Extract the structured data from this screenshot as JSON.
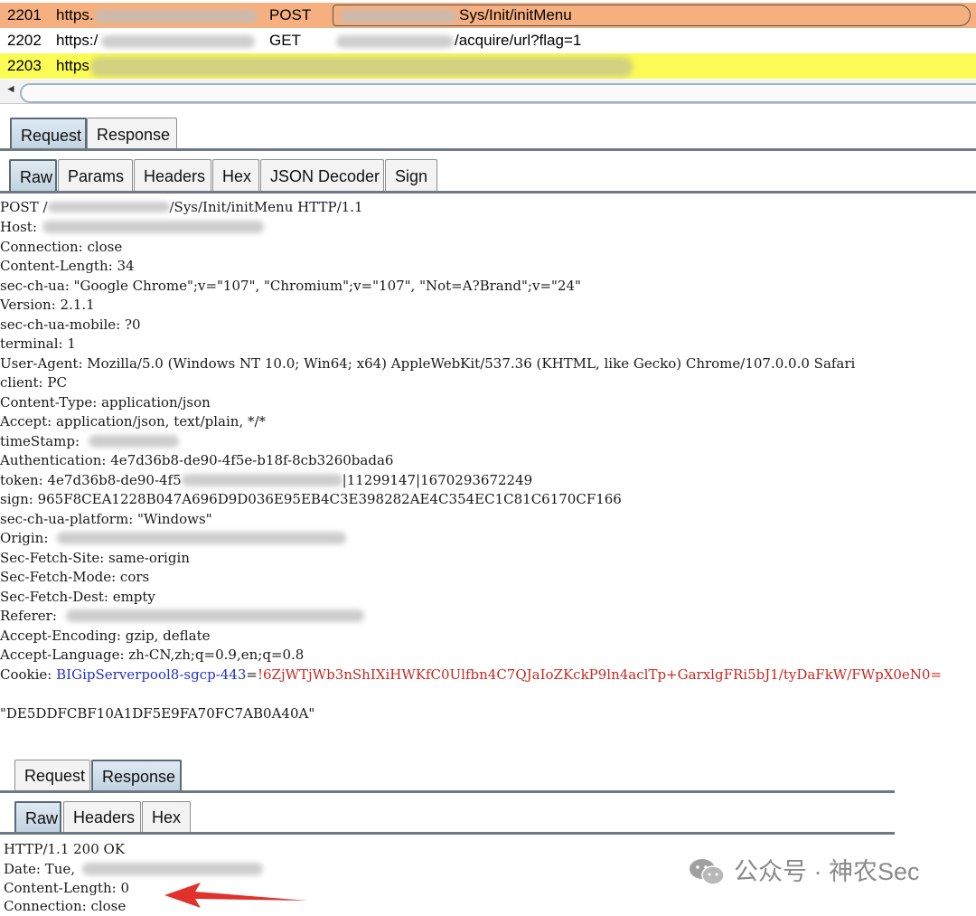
{
  "history": [
    {
      "id": "2201",
      "scheme": "https.",
      "method": "POST",
      "path": "Sys/Init/initMenu",
      "style": "orange"
    },
    {
      "id": "2202",
      "scheme": "https:/",
      "method": "GET",
      "path": "/acquire/url?flag=1",
      "style": "white"
    },
    {
      "id": "2203",
      "scheme": "https",
      "method": "",
      "path": "",
      "style": "yellow"
    }
  ],
  "request_pane": {
    "top_tabs": [
      "Request",
      "Response"
    ],
    "sub_tabs": [
      "Raw",
      "Params",
      "Headers",
      "Hex",
      "JSON Decoder",
      "Sign"
    ],
    "lines": [
      "POST /",
      "Host:",
      "Connection: close",
      "Content-Length: 34",
      "sec-ch-ua: \"Google Chrome\";v=\"107\", \"Chromium\";v=\"107\", \"Not=A?Brand\";v=\"24\"",
      "Version: 2.1.1",
      "sec-ch-ua-mobile: ?0",
      "terminal: 1",
      "User-Agent: Mozilla/5.0 (Windows NT 10.0; Win64; x64) AppleWebKit/537.36 (KHTML, like Gecko) Chrome/107.0.0.0 Safari",
      "client: PC",
      "Content-Type: application/json",
      "Accept: application/json, text/plain, */*",
      "timeStamp:",
      "Authentication: 4e7d36b8-de90-4f5e-b18f-8cb3260bada6",
      "token: 4e7d36b8-de90-4f5",
      "sign: 965F8CEA1228B047A696D9D036E95EB4C3E398282AE4C354EC1C81C6170CF166",
      "sec-ch-ua-platform: \"Windows\"",
      "Origin:",
      "Sec-Fetch-Site: same-origin",
      "Sec-Fetch-Mode: cors",
      "Sec-Fetch-Dest: empty",
      "Referer:",
      "Accept-Encoding: gzip, deflate",
      "Accept-Language: zh-CN,zh;q=0.9,en;q=0.8"
    ],
    "first_line_suffix": "/Sys/Init/initMenu HTTP/1.1",
    "token_suffix": "|11299147|1670293672249",
    "cookie": {
      "label": "Cookie:",
      "name": "BIGipServerpool8-sgcp-443",
      "eq": "=",
      "value": "!6ZjWTjWb3nShIXiHWKfC0Ulfbn4C7QJaIoZKckP9ln4aclTp+GarxlgFRi5bJ1/tyDaFkW/FWpX0eN0="
    },
    "body": "\"DE5DDFCBF10A1DF5E9FA70FC7AB0A40A\""
  },
  "response_pane": {
    "top_tabs": [
      "Request",
      "Response"
    ],
    "sub_tabs": [
      "Raw",
      "Headers",
      "Hex"
    ],
    "lines": [
      "HTTP/1.1 200 OK",
      "Date: Tue,",
      "Content-Length: 0",
      "Connection: close"
    ]
  },
  "watermark": "公众号 · 神农Sec",
  "colors": {
    "orange_row": "#f6b07f",
    "yellow_row": "#fbfb55",
    "cookie_name": "#2434c8",
    "cookie_value": "#c82820",
    "arrow": "#e0312a"
  }
}
